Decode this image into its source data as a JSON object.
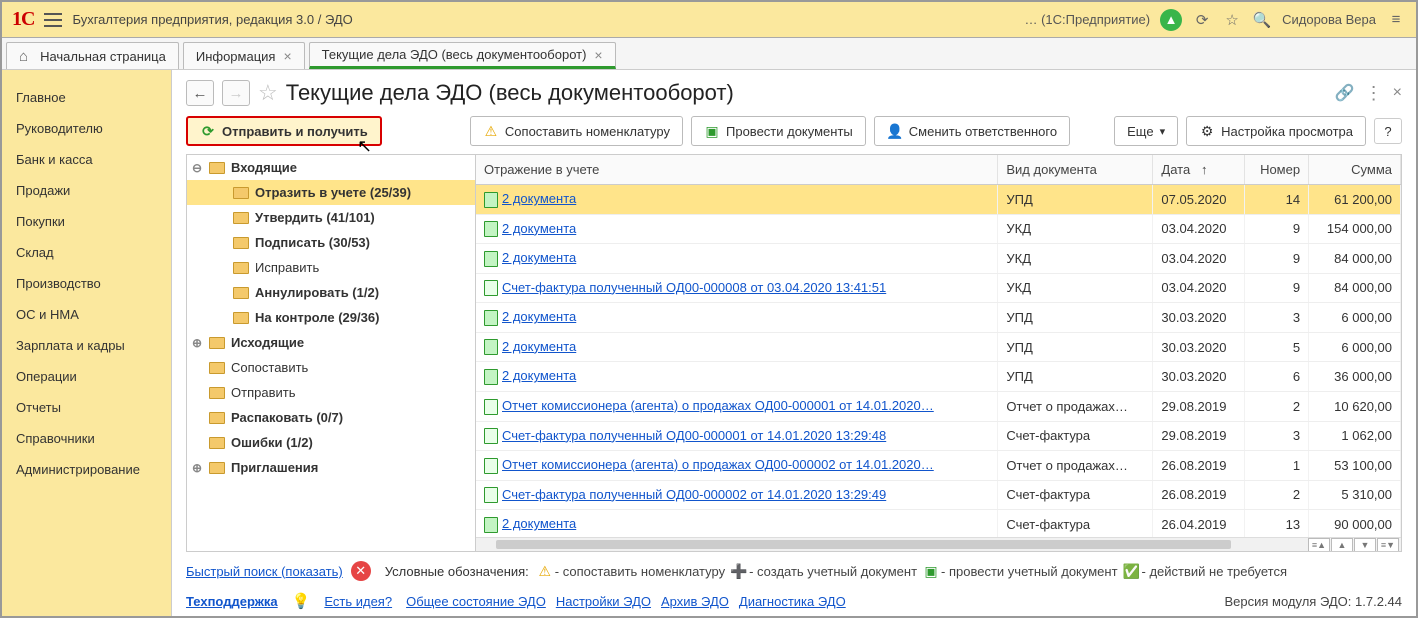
{
  "topbar": {
    "breadcrumb": "Бухгалтерия предприятия, редакция 3.0 / ЭДО",
    "context": "… (1С:Предприятие)",
    "user": "Сидорова Вера"
  },
  "tabs": [
    {
      "label": "Начальная страница",
      "closable": false,
      "home": true,
      "active": false
    },
    {
      "label": "Информация",
      "closable": true,
      "home": false,
      "active": false
    },
    {
      "label": "Текущие дела ЭДО (весь документооборот)",
      "closable": true,
      "home": false,
      "active": true
    }
  ],
  "sidenav": [
    "Главное",
    "Руководителю",
    "Банк и касса",
    "Продажи",
    "Покупки",
    "Склад",
    "Производство",
    "ОС и НМА",
    "Зарплата и кадры",
    "Операции",
    "Отчеты",
    "Справочники",
    "Администрирование"
  ],
  "page": {
    "title": "Текущие дела ЭДО (весь документооборот)"
  },
  "toolbar": {
    "send_receive": "Отправить и получить",
    "match_nomenclature": "Сопоставить номенклатуру",
    "post_documents": "Провести документы",
    "change_responsible": "Сменить ответственного",
    "more": "Еще",
    "view_settings": "Настройка просмотра",
    "help": "?"
  },
  "tree": [
    {
      "label": "Входящие",
      "bold": true,
      "indent": 1,
      "expander": "⊖",
      "selected": false
    },
    {
      "label": "Отразить в учете (25/39)",
      "bold": true,
      "indent": 2,
      "expander": "",
      "selected": true
    },
    {
      "label": "Утвердить (41/101)",
      "bold": true,
      "indent": 2,
      "expander": "",
      "selected": false
    },
    {
      "label": "Подписать (30/53)",
      "bold": true,
      "indent": 2,
      "expander": "",
      "selected": false
    },
    {
      "label": "Исправить",
      "bold": false,
      "indent": 2,
      "expander": "",
      "selected": false
    },
    {
      "label": "Аннулировать (1/2)",
      "bold": true,
      "indent": 2,
      "expander": "",
      "selected": false
    },
    {
      "label": "На контроле (29/36)",
      "bold": true,
      "indent": 2,
      "expander": "",
      "selected": false
    },
    {
      "label": "Исходящие",
      "bold": true,
      "indent": 1,
      "expander": "⊕",
      "selected": false
    },
    {
      "label": "Сопоставить",
      "bold": false,
      "indent": 1,
      "expander": "",
      "selected": false
    },
    {
      "label": "Отправить",
      "bold": false,
      "indent": 1,
      "expander": "",
      "selected": false
    },
    {
      "label": "Распаковать (0/7)",
      "bold": true,
      "indent": 1,
      "expander": "",
      "selected": false
    },
    {
      "label": "Ошибки (1/2)",
      "bold": true,
      "indent": 1,
      "expander": "",
      "selected": false
    },
    {
      "label": "Приглашения",
      "bold": true,
      "indent": 1,
      "expander": "⊕",
      "selected": false
    }
  ],
  "grid": {
    "columns": [
      "Отражение в учете",
      "Вид документа",
      "Дата",
      "Номер",
      "Сумма"
    ],
    "sort_arrow_col": 2,
    "rows": [
      {
        "link": "2 документа",
        "type": "УПД",
        "date": "07.05.2020",
        "num": "14",
        "sum": "61 200,00",
        "icon": "post",
        "sel": true
      },
      {
        "link": "2 документа",
        "type": "УКД",
        "date": "03.04.2020",
        "num": "9",
        "sum": "154 000,00",
        "icon": "post",
        "sel": false
      },
      {
        "link": "2 документа",
        "type": "УКД",
        "date": "03.04.2020",
        "num": "9",
        "sum": "84 000,00",
        "icon": "post",
        "sel": false
      },
      {
        "link": "Счет-фактура полученный ОД00-000008 от 03.04.2020 13:41:51",
        "type": "УКД",
        "date": "03.04.2020",
        "num": "9",
        "sum": "84 000,00",
        "icon": "doc",
        "sel": false
      },
      {
        "link": "2 документа",
        "type": "УПД",
        "date": "30.03.2020",
        "num": "3",
        "sum": "6 000,00",
        "icon": "post",
        "sel": false
      },
      {
        "link": "2 документа",
        "type": "УПД",
        "date": "30.03.2020",
        "num": "5",
        "sum": "6 000,00",
        "icon": "post",
        "sel": false
      },
      {
        "link": "2 документа",
        "type": "УПД",
        "date": "30.03.2020",
        "num": "6",
        "sum": "36 000,00",
        "icon": "post",
        "sel": false
      },
      {
        "link": "Отчет комиссионера (агента) о продажах ОД00-000001 от 14.01.2020…",
        "type": "Отчет о продажах…",
        "date": "29.08.2019",
        "num": "2",
        "sum": "10 620,00",
        "icon": "doc",
        "sel": false
      },
      {
        "link": "Счет-фактура полученный ОД00-000001 от 14.01.2020 13:29:48",
        "type": "Счет-фактура",
        "date": "29.08.2019",
        "num": "3",
        "sum": "1 062,00",
        "icon": "doc",
        "sel": false
      },
      {
        "link": "Отчет комиссионера (агента) о продажах ОД00-000002 от 14.01.2020…",
        "type": "Отчет о продажах…",
        "date": "26.08.2019",
        "num": "1",
        "sum": "53 100,00",
        "icon": "doc",
        "sel": false
      },
      {
        "link": "Счет-фактура полученный ОД00-000002 от 14.01.2020 13:29:49",
        "type": "Счет-фактура",
        "date": "26.08.2019",
        "num": "2",
        "sum": "5 310,00",
        "icon": "doc",
        "sel": false
      },
      {
        "link": "2 документа",
        "type": "Счет-фактура",
        "date": "26.04.2019",
        "num": "13",
        "sum": "90 000,00",
        "icon": "post",
        "sel": false
      }
    ]
  },
  "low1": {
    "quick_search": "Быстрый поиск (показать)",
    "legend_label": "Условные обозначения:",
    "legend": [
      {
        "icon": "warn",
        "text": "- сопоставить номенклатуру"
      },
      {
        "icon": "plus",
        "text": "- создать учетный документ"
      },
      {
        "icon": "post",
        "text": "- провести учетный документ"
      },
      {
        "icon": "ok",
        "text": "- действий не требуется"
      }
    ]
  },
  "low2": {
    "support": "Техподдержка",
    "idea": "Есть идея?",
    "links": [
      "Общее состояние ЭДО",
      "Настройки ЭДО",
      "Архив ЭДО",
      "Диагностика ЭДО"
    ],
    "version": "Версия модуля ЭДО: 1.7.2.44"
  }
}
